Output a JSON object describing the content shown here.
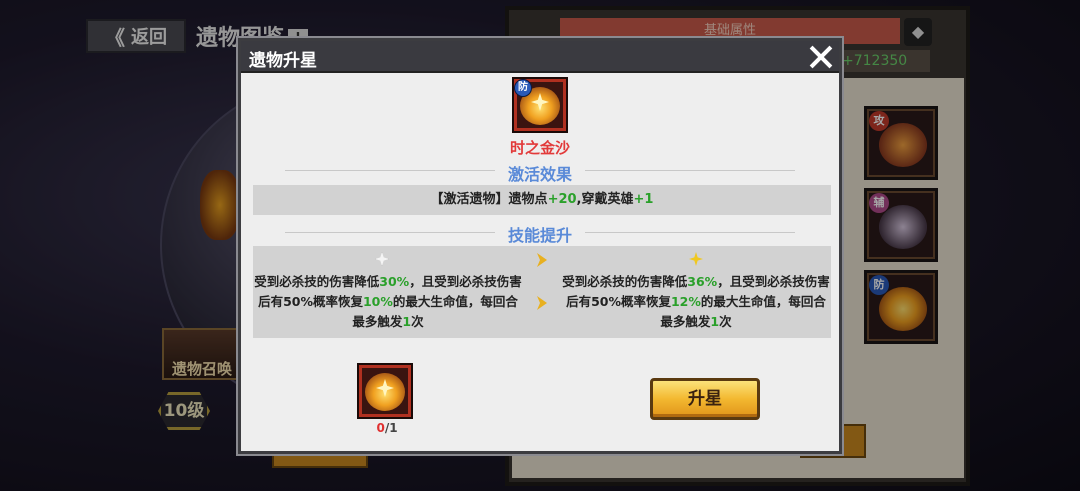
{
  "background": {
    "back_label": "返回",
    "page_title": "遗物图鉴",
    "info_label": "!",
    "summon_label": "遗物召唤",
    "level_label": "10级",
    "panel_tab_label": "基础属性",
    "panel_stat": "+712350",
    "card_tags": [
      "攻",
      "辅",
      "防"
    ]
  },
  "dialog": {
    "title": "遗物升星",
    "relic": {
      "badge": "防",
      "name": "时之金沙"
    },
    "activation": {
      "section_title": "激活效果",
      "prefix": "【激活遗物】遗物点",
      "points": "+20",
      "middle": ",穿戴英雄",
      "heroes": "+1"
    },
    "skill": {
      "section_title": "技能提升",
      "current": {
        "p1": "受到必杀技的伤害降低",
        "v1": "30%",
        "p2": "，且受到必杀技伤害后有50%概率恢复",
        "v2": "10%",
        "p3": "的最大生命值，每回合最多触发",
        "v3": "1",
        "p4": "次"
      },
      "next": {
        "p1": "受到必杀技的伤害降低",
        "v1": "36%",
        "p2": "，且受到必杀技伤害后有50%概率恢复",
        "v2": "12%",
        "p3": "的最大生命值，每回合最多触发",
        "v3": "1",
        "p4": "次"
      }
    },
    "cost": {
      "have": "0",
      "need": "/1"
    },
    "upgrade_label": "升星"
  }
}
